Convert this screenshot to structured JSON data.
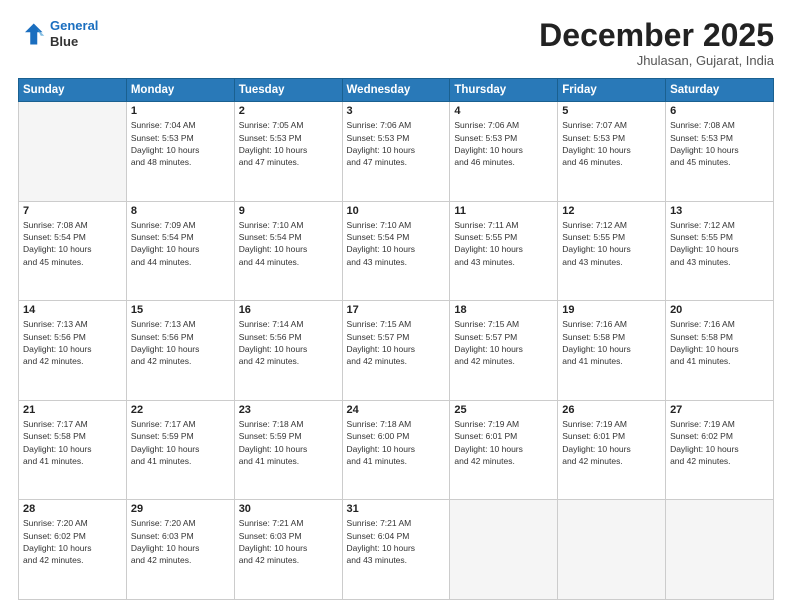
{
  "header": {
    "logo_line1": "General",
    "logo_line2": "Blue",
    "month": "December 2025",
    "location": "Jhulasan, Gujarat, India"
  },
  "weekdays": [
    "Sunday",
    "Monday",
    "Tuesday",
    "Wednesday",
    "Thursday",
    "Friday",
    "Saturday"
  ],
  "weeks": [
    [
      {
        "day": "",
        "info": ""
      },
      {
        "day": "1",
        "info": "Sunrise: 7:04 AM\nSunset: 5:53 PM\nDaylight: 10 hours\nand 48 minutes."
      },
      {
        "day": "2",
        "info": "Sunrise: 7:05 AM\nSunset: 5:53 PM\nDaylight: 10 hours\nand 47 minutes."
      },
      {
        "day": "3",
        "info": "Sunrise: 7:06 AM\nSunset: 5:53 PM\nDaylight: 10 hours\nand 47 minutes."
      },
      {
        "day": "4",
        "info": "Sunrise: 7:06 AM\nSunset: 5:53 PM\nDaylight: 10 hours\nand 46 minutes."
      },
      {
        "day": "5",
        "info": "Sunrise: 7:07 AM\nSunset: 5:53 PM\nDaylight: 10 hours\nand 46 minutes."
      },
      {
        "day": "6",
        "info": "Sunrise: 7:08 AM\nSunset: 5:53 PM\nDaylight: 10 hours\nand 45 minutes."
      }
    ],
    [
      {
        "day": "7",
        "info": "Sunrise: 7:08 AM\nSunset: 5:54 PM\nDaylight: 10 hours\nand 45 minutes."
      },
      {
        "day": "8",
        "info": "Sunrise: 7:09 AM\nSunset: 5:54 PM\nDaylight: 10 hours\nand 44 minutes."
      },
      {
        "day": "9",
        "info": "Sunrise: 7:10 AM\nSunset: 5:54 PM\nDaylight: 10 hours\nand 44 minutes."
      },
      {
        "day": "10",
        "info": "Sunrise: 7:10 AM\nSunset: 5:54 PM\nDaylight: 10 hours\nand 43 minutes."
      },
      {
        "day": "11",
        "info": "Sunrise: 7:11 AM\nSunset: 5:55 PM\nDaylight: 10 hours\nand 43 minutes."
      },
      {
        "day": "12",
        "info": "Sunrise: 7:12 AM\nSunset: 5:55 PM\nDaylight: 10 hours\nand 43 minutes."
      },
      {
        "day": "13",
        "info": "Sunrise: 7:12 AM\nSunset: 5:55 PM\nDaylight: 10 hours\nand 43 minutes."
      }
    ],
    [
      {
        "day": "14",
        "info": "Sunrise: 7:13 AM\nSunset: 5:56 PM\nDaylight: 10 hours\nand 42 minutes."
      },
      {
        "day": "15",
        "info": "Sunrise: 7:13 AM\nSunset: 5:56 PM\nDaylight: 10 hours\nand 42 minutes."
      },
      {
        "day": "16",
        "info": "Sunrise: 7:14 AM\nSunset: 5:56 PM\nDaylight: 10 hours\nand 42 minutes."
      },
      {
        "day": "17",
        "info": "Sunrise: 7:15 AM\nSunset: 5:57 PM\nDaylight: 10 hours\nand 42 minutes."
      },
      {
        "day": "18",
        "info": "Sunrise: 7:15 AM\nSunset: 5:57 PM\nDaylight: 10 hours\nand 42 minutes."
      },
      {
        "day": "19",
        "info": "Sunrise: 7:16 AM\nSunset: 5:58 PM\nDaylight: 10 hours\nand 41 minutes."
      },
      {
        "day": "20",
        "info": "Sunrise: 7:16 AM\nSunset: 5:58 PM\nDaylight: 10 hours\nand 41 minutes."
      }
    ],
    [
      {
        "day": "21",
        "info": "Sunrise: 7:17 AM\nSunset: 5:58 PM\nDaylight: 10 hours\nand 41 minutes."
      },
      {
        "day": "22",
        "info": "Sunrise: 7:17 AM\nSunset: 5:59 PM\nDaylight: 10 hours\nand 41 minutes."
      },
      {
        "day": "23",
        "info": "Sunrise: 7:18 AM\nSunset: 5:59 PM\nDaylight: 10 hours\nand 41 minutes."
      },
      {
        "day": "24",
        "info": "Sunrise: 7:18 AM\nSunset: 6:00 PM\nDaylight: 10 hours\nand 41 minutes."
      },
      {
        "day": "25",
        "info": "Sunrise: 7:19 AM\nSunset: 6:01 PM\nDaylight: 10 hours\nand 42 minutes."
      },
      {
        "day": "26",
        "info": "Sunrise: 7:19 AM\nSunset: 6:01 PM\nDaylight: 10 hours\nand 42 minutes."
      },
      {
        "day": "27",
        "info": "Sunrise: 7:19 AM\nSunset: 6:02 PM\nDaylight: 10 hours\nand 42 minutes."
      }
    ],
    [
      {
        "day": "28",
        "info": "Sunrise: 7:20 AM\nSunset: 6:02 PM\nDaylight: 10 hours\nand 42 minutes."
      },
      {
        "day": "29",
        "info": "Sunrise: 7:20 AM\nSunset: 6:03 PM\nDaylight: 10 hours\nand 42 minutes."
      },
      {
        "day": "30",
        "info": "Sunrise: 7:21 AM\nSunset: 6:03 PM\nDaylight: 10 hours\nand 42 minutes."
      },
      {
        "day": "31",
        "info": "Sunrise: 7:21 AM\nSunset: 6:04 PM\nDaylight: 10 hours\nand 43 minutes."
      },
      {
        "day": "",
        "info": ""
      },
      {
        "day": "",
        "info": ""
      },
      {
        "day": "",
        "info": ""
      }
    ]
  ]
}
